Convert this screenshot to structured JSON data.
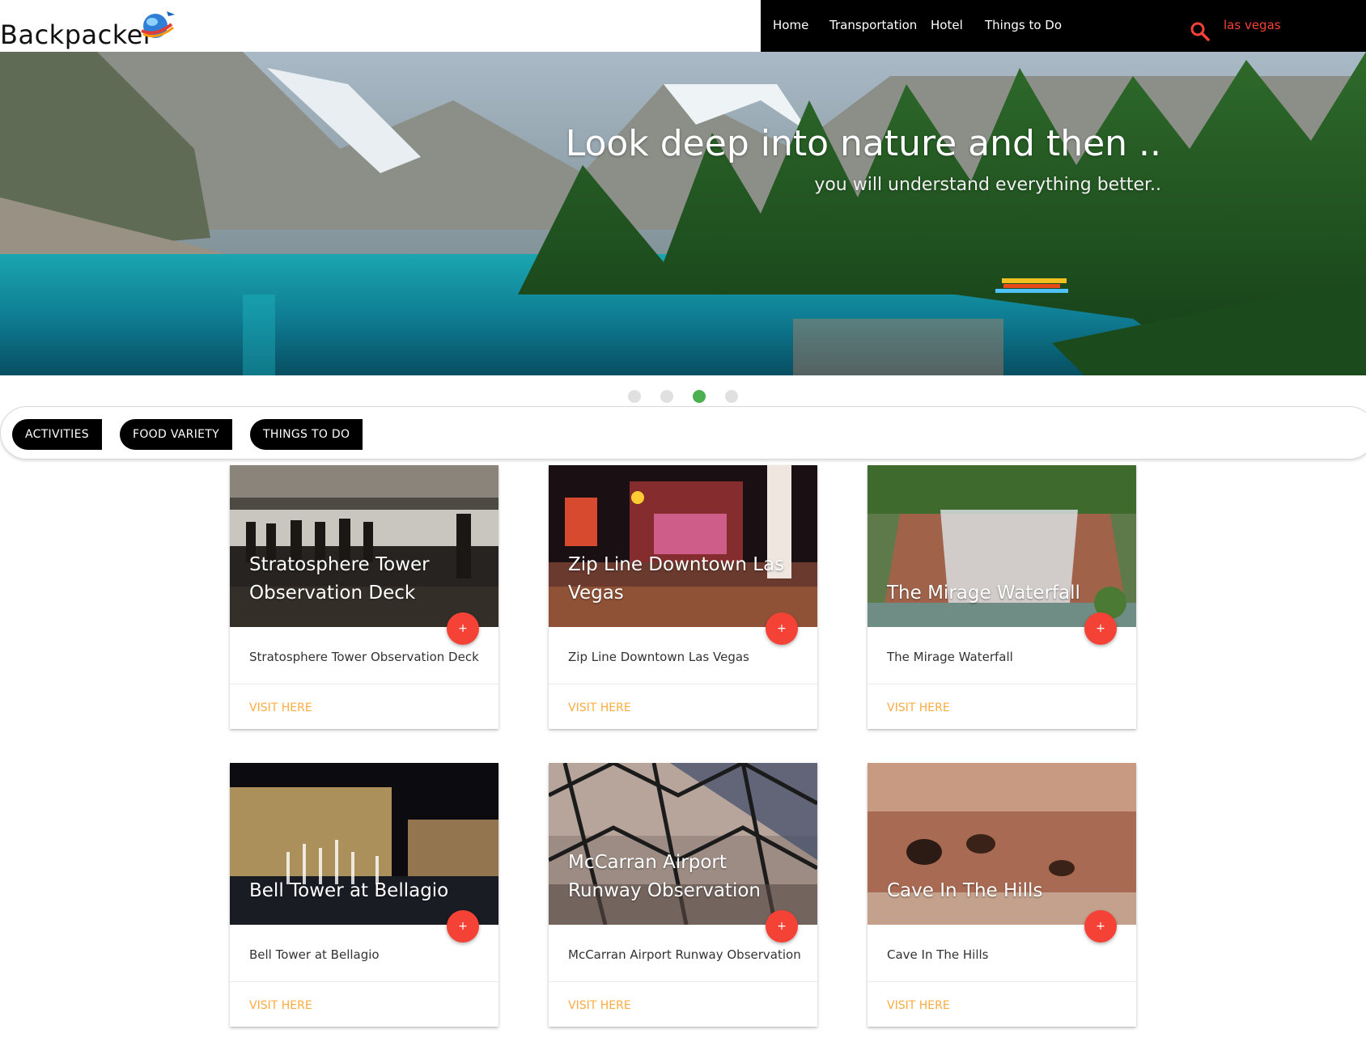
{
  "brand": {
    "name": "Backpacker"
  },
  "nav": {
    "items": [
      {
        "label": "Home"
      },
      {
        "label": "Transportation"
      },
      {
        "label": "Hotel"
      },
      {
        "label": "Things to Do"
      }
    ],
    "search_value": "las vegas"
  },
  "hero": {
    "title": "Look deep into nature and then ..",
    "subtitle": "you will understand everything better..",
    "slides_total": 4,
    "active_slide": 3
  },
  "tabs": [
    {
      "label": "ACTIVITIES"
    },
    {
      "label": "FOOD VARIETY"
    },
    {
      "label": "THINGS TO DO"
    }
  ],
  "cards": [
    {
      "title": "Stratosphere Tower Observation Deck",
      "fab": "+",
      "link": "VISIT HERE"
    },
    {
      "title": "Zip Line Downtown Las Vegas",
      "fab": "+",
      "link": "VISIT HERE"
    },
    {
      "title": "The Mirage Waterfall",
      "fab": "+",
      "link": "VISIT HERE"
    },
    {
      "title": "Bell Tower at Bellagio",
      "fab": "+",
      "link": "VISIT HERE"
    },
    {
      "title": "McCarran Airport Runway Observation",
      "fab": "+",
      "link": "VISIT HERE"
    },
    {
      "title": "Cave In The Hills",
      "fab": "+",
      "link": "VISIT HERE"
    }
  ],
  "colors": {
    "navbar": "#000000",
    "search_accent": "#f44336",
    "fab": "#f44336",
    "link": "#ffab40",
    "active_dot": "#4caf50",
    "inactive_dot": "#e0e0e0"
  }
}
